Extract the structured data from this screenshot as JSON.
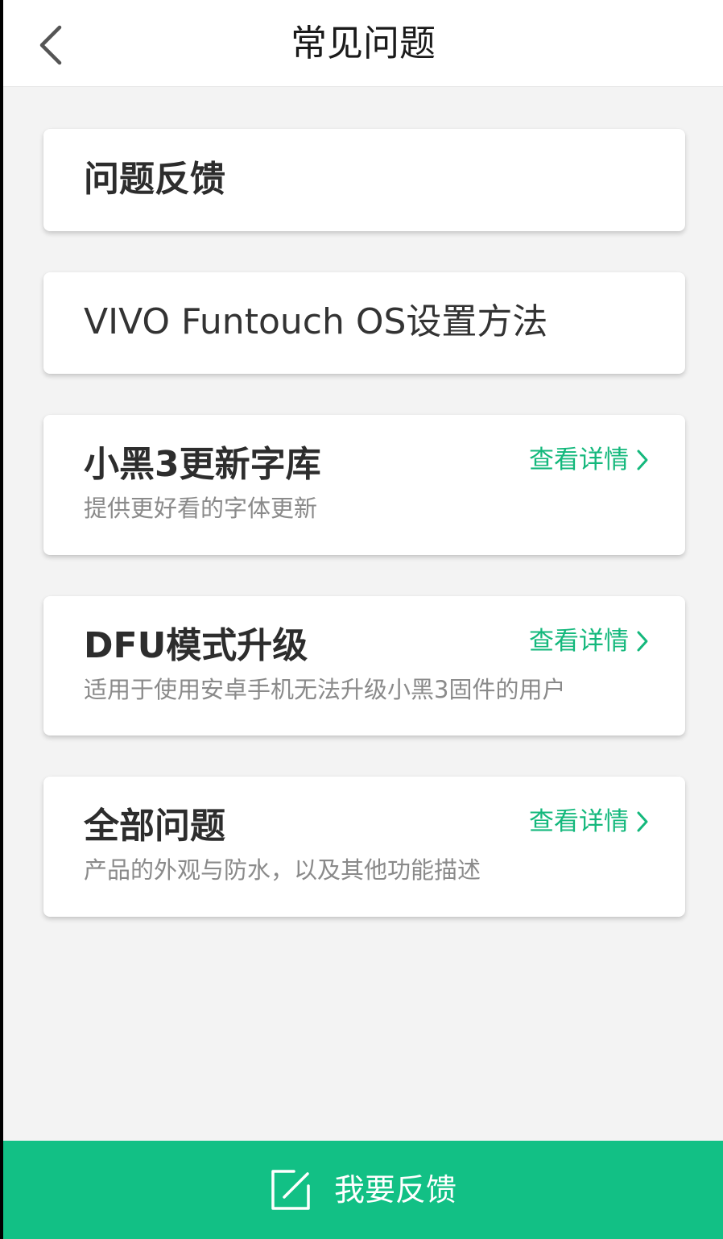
{
  "header": {
    "title": "常见问题",
    "back_icon": "chevron-left-icon"
  },
  "cards": [
    {
      "title": "问题反馈"
    },
    {
      "title": "VIVO Funtouch OS设置方法"
    },
    {
      "title": "小黑3更新字库",
      "subtitle": "提供更好看的字体更新",
      "link": "查看详情"
    },
    {
      "title": "DFU模式升级",
      "subtitle": "适用于使用安卓手机无法升级小黑3固件的用户",
      "link": "查看详情"
    },
    {
      "title": "全部问题",
      "subtitle": "产品的外观与防水，以及其他功能描述",
      "link": "查看详情"
    }
  ],
  "bottom_bar": {
    "label": "我要反馈",
    "icon": "edit-icon"
  },
  "colors": {
    "accent": "#12c085",
    "link": "#14b87c",
    "background": "#f3f3f3"
  }
}
